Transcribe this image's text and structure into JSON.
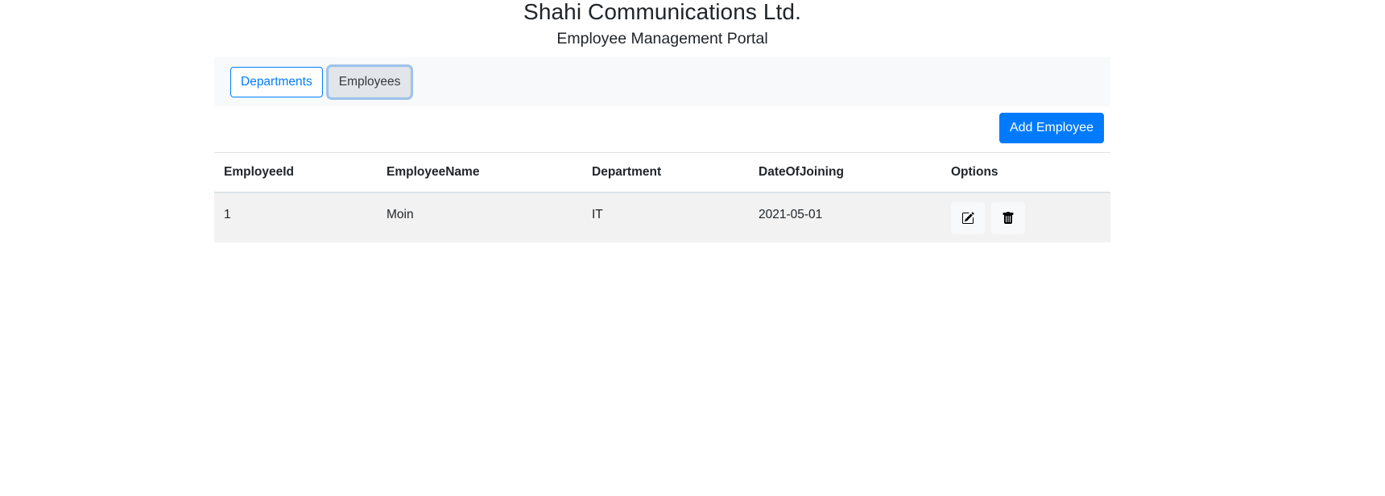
{
  "header": {
    "title": "Shahi Communications Ltd.",
    "subtitle": "Employee Management Portal"
  },
  "nav": {
    "items": [
      {
        "label": "Departments",
        "active": false
      },
      {
        "label": "Employees",
        "active": true
      }
    ]
  },
  "toolbar": {
    "add_label": "Add Employee"
  },
  "table": {
    "columns": [
      "EmployeeId",
      "EmployeeName",
      "Department",
      "DateOfJoining",
      "Options"
    ],
    "rows": [
      {
        "EmployeeId": "1",
        "EmployeeName": "Moin",
        "Department": "IT",
        "DateOfJoining": "2021-05-01"
      }
    ]
  },
  "icons": {
    "edit": "pencil-square-icon",
    "delete": "trash-icon"
  },
  "colors": {
    "primary": "#007bff",
    "navbar_bg": "#f8f9fa",
    "row_bg": "#f2f2f2",
    "text": "#212529"
  }
}
